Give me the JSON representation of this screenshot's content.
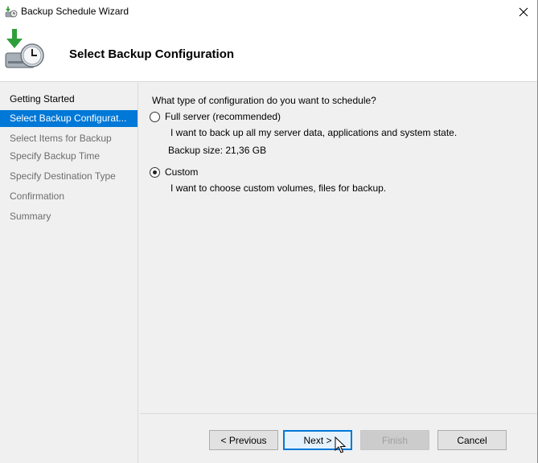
{
  "window": {
    "title": "Backup Schedule Wizard",
    "header_title": "Select Backup Configuration"
  },
  "nav": {
    "items": [
      {
        "label": "Getting Started",
        "state": "done"
      },
      {
        "label": "Select Backup Configurat...",
        "state": "active"
      },
      {
        "label": "Select Items for Backup",
        "state": "pending"
      },
      {
        "label": "Specify Backup Time",
        "state": "pending"
      },
      {
        "label": "Specify Destination Type",
        "state": "pending"
      },
      {
        "label": "Confirmation",
        "state": "pending"
      },
      {
        "label": "Summary",
        "state": "pending"
      }
    ]
  },
  "content": {
    "question": "What type of configuration do you want to schedule?",
    "options": [
      {
        "label": "Full server (recommended)",
        "checked": false,
        "description": "I want to back up all my server data, applications and system state.",
        "extra": "Backup size: 21,36 GB"
      },
      {
        "label": "Custom",
        "checked": true,
        "description": "I want to choose custom volumes, files for backup."
      }
    ]
  },
  "buttons": {
    "previous": "< Previous",
    "next": "Next >",
    "finish": "Finish",
    "cancel": "Cancel"
  },
  "colors": {
    "accent": "#0078d7",
    "background": "#f0f0f0"
  }
}
